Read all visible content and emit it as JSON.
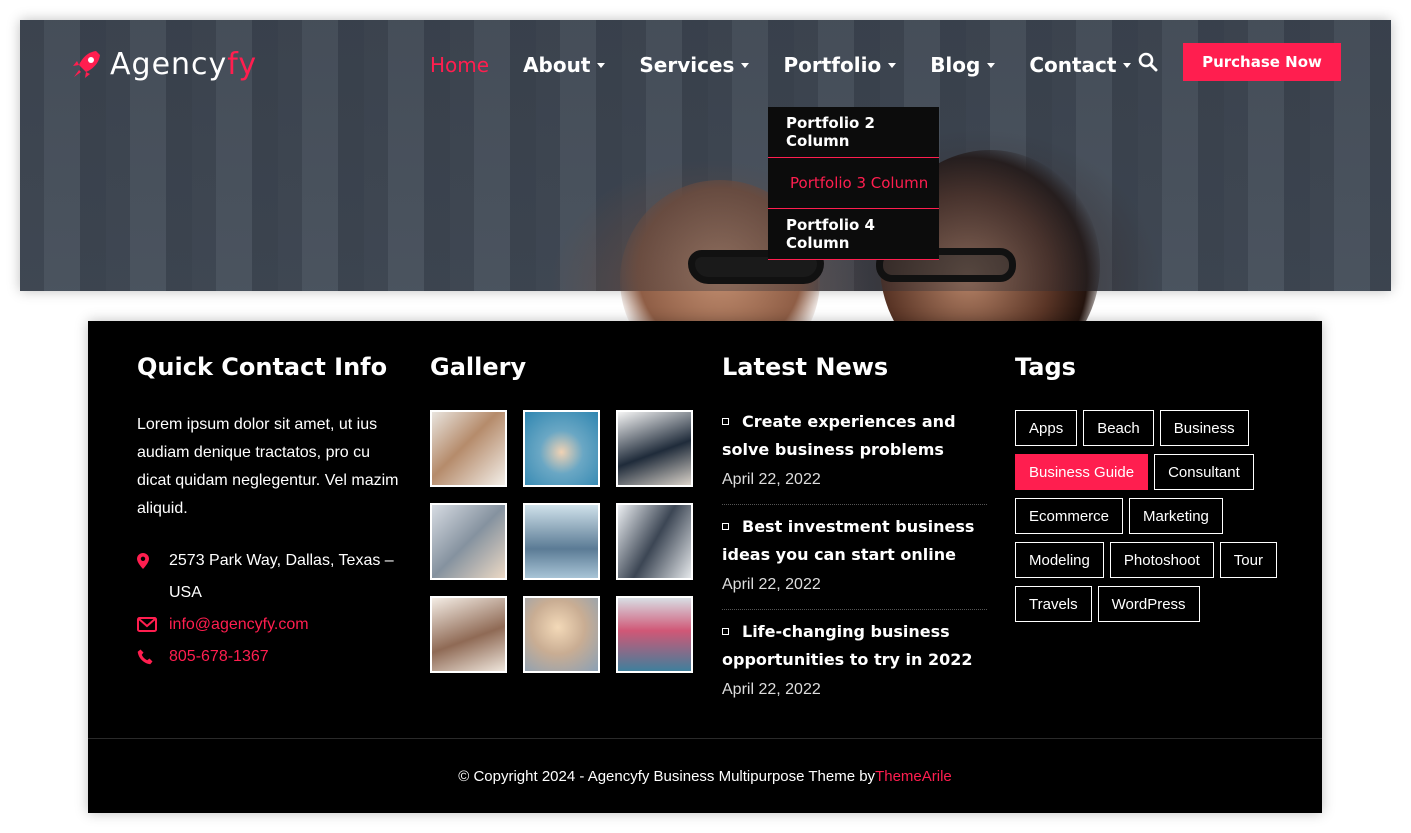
{
  "colors": {
    "accent": "#ff1e4f",
    "footer_bg": "#000000",
    "dropdown_bg": "#0c0c0c"
  },
  "header": {
    "logo": {
      "text_main": "Agency",
      "text_accent": "fy",
      "icon": "rocket-icon"
    },
    "nav": [
      {
        "label": "Home",
        "has_caret": false,
        "active": true
      },
      {
        "label": "About",
        "has_caret": true
      },
      {
        "label": "Services",
        "has_caret": true
      },
      {
        "label": "Portfolio",
        "has_caret": true
      },
      {
        "label": "Blog",
        "has_caret": true
      },
      {
        "label": "Contact",
        "has_caret": true
      }
    ],
    "search_icon": "search-icon",
    "purchase_label": "Purchase Now",
    "portfolio_dropdown": [
      {
        "label": "Portfolio 2 Column"
      },
      {
        "label": "Portfolio 3 Column",
        "active": true
      },
      {
        "label": "Portfolio 4 Column"
      }
    ]
  },
  "footer": {
    "contact": {
      "title": "Quick Contact Info",
      "text": "Lorem ipsum dolor sit amet, ut ius audiam denique tractatos, pro cu dicat quidam neglegentur. Vel mazim aliquid.",
      "address": "2573 Park Way, Dallas, Texas – USA",
      "email": "info@agencyfy.com",
      "phone": "805-678-1367"
    },
    "gallery": {
      "title": "Gallery"
    },
    "news": {
      "title": "Latest News",
      "items": [
        {
          "title": "Create experiences and solve business problems",
          "date": "April 22, 2022"
        },
        {
          "title": "Best investment business ideas you can start online",
          "date": "April 22, 2022"
        },
        {
          "title": "Life-changing business opportunities to try in 2022",
          "date": "April 22, 2022"
        }
      ]
    },
    "tags": {
      "title": "Tags",
      "items": [
        "Apps",
        "Beach",
        "Business",
        "Business Guide",
        "Consultant",
        "Ecommerce",
        "Marketing",
        "Modeling",
        "Photoshoot",
        "Tour",
        "Travels",
        "WordPress"
      ],
      "active": "Business Guide"
    },
    "copyright": {
      "text": "© Copyright 2024 - Agencyfy Business Multipurpose Theme by ",
      "brand": "ThemeArile"
    }
  }
}
